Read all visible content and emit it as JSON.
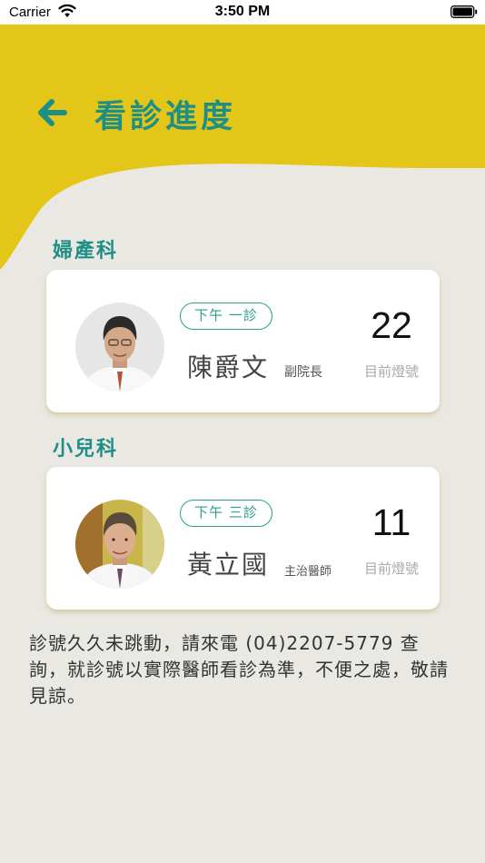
{
  "status_bar": {
    "carrier": "Carrier",
    "time": "3:50 PM",
    "icons": [
      "wifi-icon",
      "battery-icon"
    ]
  },
  "header": {
    "title": "看診進度",
    "back_icon": "arrow-left-icon"
  },
  "colors": {
    "header_yellow": "#e3c618",
    "accent_teal": "#1f8f86",
    "background": "#e9e8e2",
    "card": "#ffffff"
  },
  "departments": [
    {
      "name": "婦產科",
      "session": "下午 一診",
      "doctor_name": "陳爵文",
      "doctor_title": "副院長",
      "current_number": "22",
      "number_label": "目前燈號"
    },
    {
      "name": "小兒科",
      "session": "下午 三診",
      "doctor_name": "黃立國",
      "doctor_title": "主治醫師",
      "current_number": "11",
      "number_label": "目前燈號"
    }
  ],
  "notice": "診號久久未跳動，請來電 (04)2207-5779 查詢，就診號以實際醫師看診為準，不便之處，敬請見諒。"
}
